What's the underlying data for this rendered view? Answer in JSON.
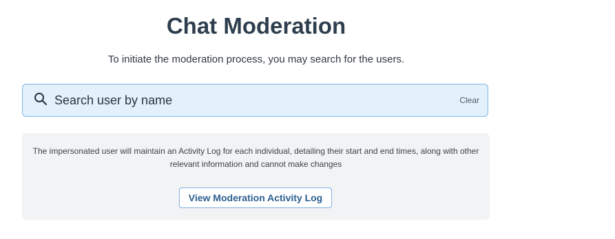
{
  "header": {
    "title": "Chat Moderation",
    "subtitle": "To initiate the moderation process, you may search for the users."
  },
  "search": {
    "icon": "search-icon",
    "placeholder": "Search user by name",
    "value": "",
    "clear_label": "Clear"
  },
  "info": {
    "text": "The impersonated user will maintain an Activity Log for each individual, detailing their start and end times, along with other relevant information and cannot make changes",
    "button_label": "View Moderation Activity Log"
  },
  "colors": {
    "title": "#2f3e4e",
    "search_background": "#e3f1fd",
    "search_border": "#7eb6e6",
    "panel_background": "#f2f3f4",
    "button_border": "#7fb0df",
    "button_text": "#2b5e8f"
  }
}
